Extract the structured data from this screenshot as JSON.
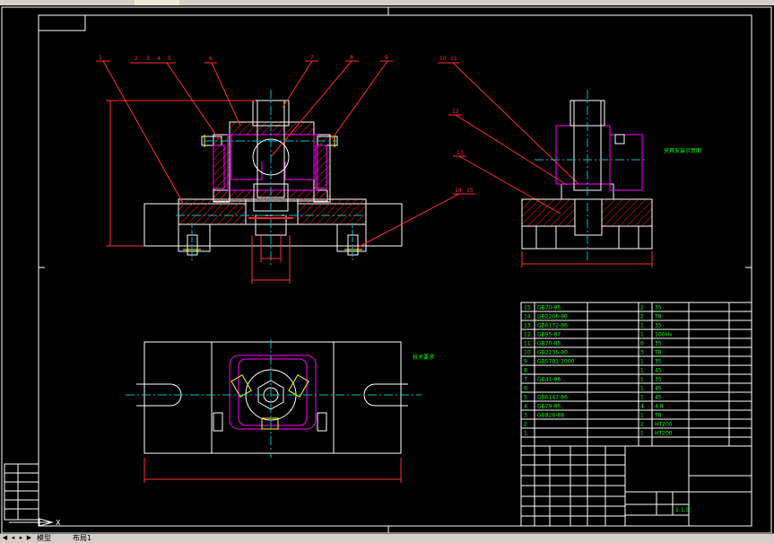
{
  "balloons": {
    "b1": "1",
    "b2": "2",
    "b3": "3",
    "b4": "4",
    "b5": "5",
    "b6": "6",
    "b7": "7",
    "b8": "8",
    "b9": "9",
    "b10": "10",
    "b11": "11",
    "b12": "12",
    "b13": "13",
    "b14": "14",
    "b15": "15"
  },
  "parts_list": [
    {
      "no": "15",
      "code": "GB70-85",
      "qty": "2",
      "mat": "35"
    },
    {
      "no": "14",
      "code": "GB2206-80",
      "qty": "2",
      "mat": "T8"
    },
    {
      "no": "13",
      "code": "GB6172-86",
      "qty": "1",
      "mat": "35"
    },
    {
      "no": "12",
      "code": "GB95-87",
      "qty": "1",
      "mat": "100Hv"
    },
    {
      "no": "11",
      "code": "GB70-85",
      "qty": "6",
      "mat": "35"
    },
    {
      "no": "10",
      "code": "GB2236-80",
      "qty": "3",
      "mat": "T8"
    },
    {
      "no": "9",
      "code": "GB5781-2000",
      "qty": "1",
      "mat": "35"
    },
    {
      "no": "8",
      "code": "",
      "qty": "1",
      "mat": "45"
    },
    {
      "no": "7",
      "code": "GB41-86",
      "qty": "1",
      "mat": "35"
    },
    {
      "no": "6",
      "code": "",
      "qty": "1",
      "mat": "45"
    },
    {
      "no": "5",
      "code": "GB6147-86",
      "qty": "1",
      "mat": "45"
    },
    {
      "no": "4",
      "code": "GB79-85",
      "qty": "4",
      "mat": "4.8"
    },
    {
      "no": "3",
      "code": "GB828-88",
      "qty": "1",
      "mat": "T8"
    },
    {
      "no": "2",
      "code": "",
      "qty": "2",
      "mat": "HT200"
    },
    {
      "no": "1",
      "code": "",
      "qty": "1",
      "mat": "HT200"
    }
  ],
  "title_block": {
    "scale": "1:1.5"
  },
  "dims": {
    "d1": "",
    "d2": ""
  },
  "statusbar": {
    "tab_model": "模型",
    "tab_layout": "布局1",
    "axis_x": "X"
  },
  "colors": {
    "line_white": "#ffffff",
    "hatch_red": "#ff2020",
    "part_magenta": "#ff00ff",
    "axis_cyan": "#00c0c0",
    "text_green": "#00ff00",
    "dim_red": "#ff3030",
    "yellow": "#ffff00"
  }
}
